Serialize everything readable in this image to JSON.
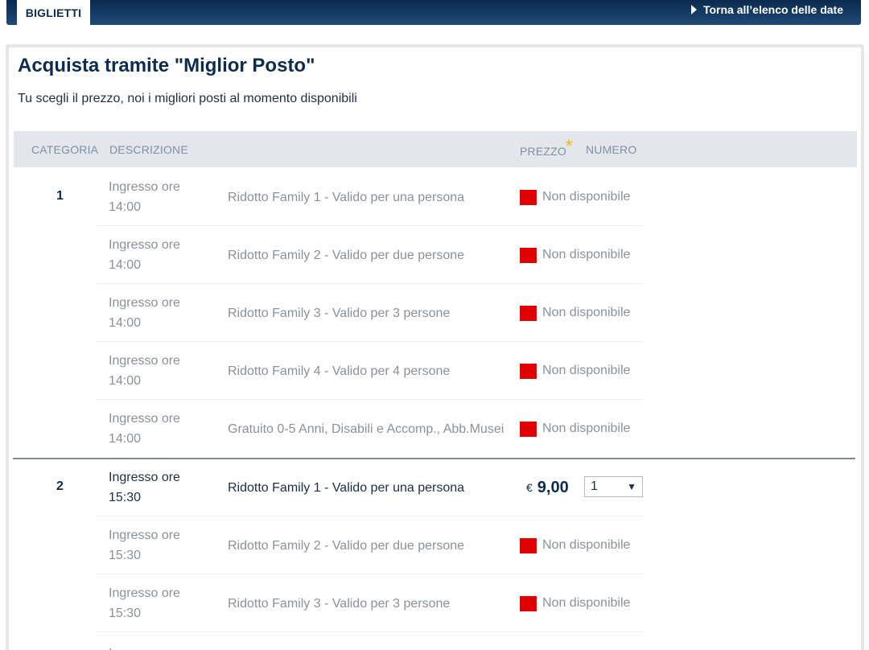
{
  "header": {
    "tab_label": "BIGLIETTI",
    "back_link": "Torna all’elenco delle date"
  },
  "title": "Acquista tramite \"Miglior Posto\"",
  "subtitle": "Tu scegli il prezzo, noi i migliori posti al momento disponibili",
  "table": {
    "headers": {
      "categoria": "CATEGORIA",
      "descrizione": "DESCRIZIONE",
      "prezzo": "PREZZO",
      "prezzo_marker": "*",
      "numero": "NUMERO"
    },
    "categories": [
      {
        "number": "1",
        "rows": [
          {
            "time": "Ingresso ore 14:00",
            "desc": "Ridotto Family 1 - Valido per una persona",
            "status": "Non disponibile"
          },
          {
            "time": "Ingresso ore 14:00",
            "desc": "Ridotto Family 2 - Valido per due persone",
            "status": "Non disponibile"
          },
          {
            "time": "Ingresso ore 14:00",
            "desc": "Ridotto Family 3 - Valido per 3 persone",
            "status": "Non disponibile"
          },
          {
            "time": "Ingresso ore 14:00",
            "desc": "Ridotto Family 4 - Valido per 4 persone",
            "status": "Non disponibile"
          },
          {
            "time": "Ingresso ore 14:00",
            "desc": "Gratuito 0-5 Anni, Disabili e Accomp., Abb.Musei",
            "status": "Non disponibile"
          }
        ]
      },
      {
        "number": "2",
        "rows": [
          {
            "time": "Ingresso ore 15:30",
            "desc": "Ridotto Family 1 - Valido per una persona",
            "currency": "€",
            "price": "9,00",
            "quantity": "1"
          },
          {
            "time": "Ingresso ore 15:30",
            "desc": "Ridotto Family 2 - Valido per due persone",
            "status": "Non disponibile"
          },
          {
            "time": "Ingresso ore 15:30",
            "desc": "Ridotto Family 3 - Valido per 3 persone",
            "status": "Non disponibile"
          },
          {
            "time": "Ingresso ore"
          }
        ]
      }
    ]
  },
  "colors": {
    "navy": "#0d2b4e",
    "unavailable": "#e00000",
    "star": "#f5b800"
  }
}
